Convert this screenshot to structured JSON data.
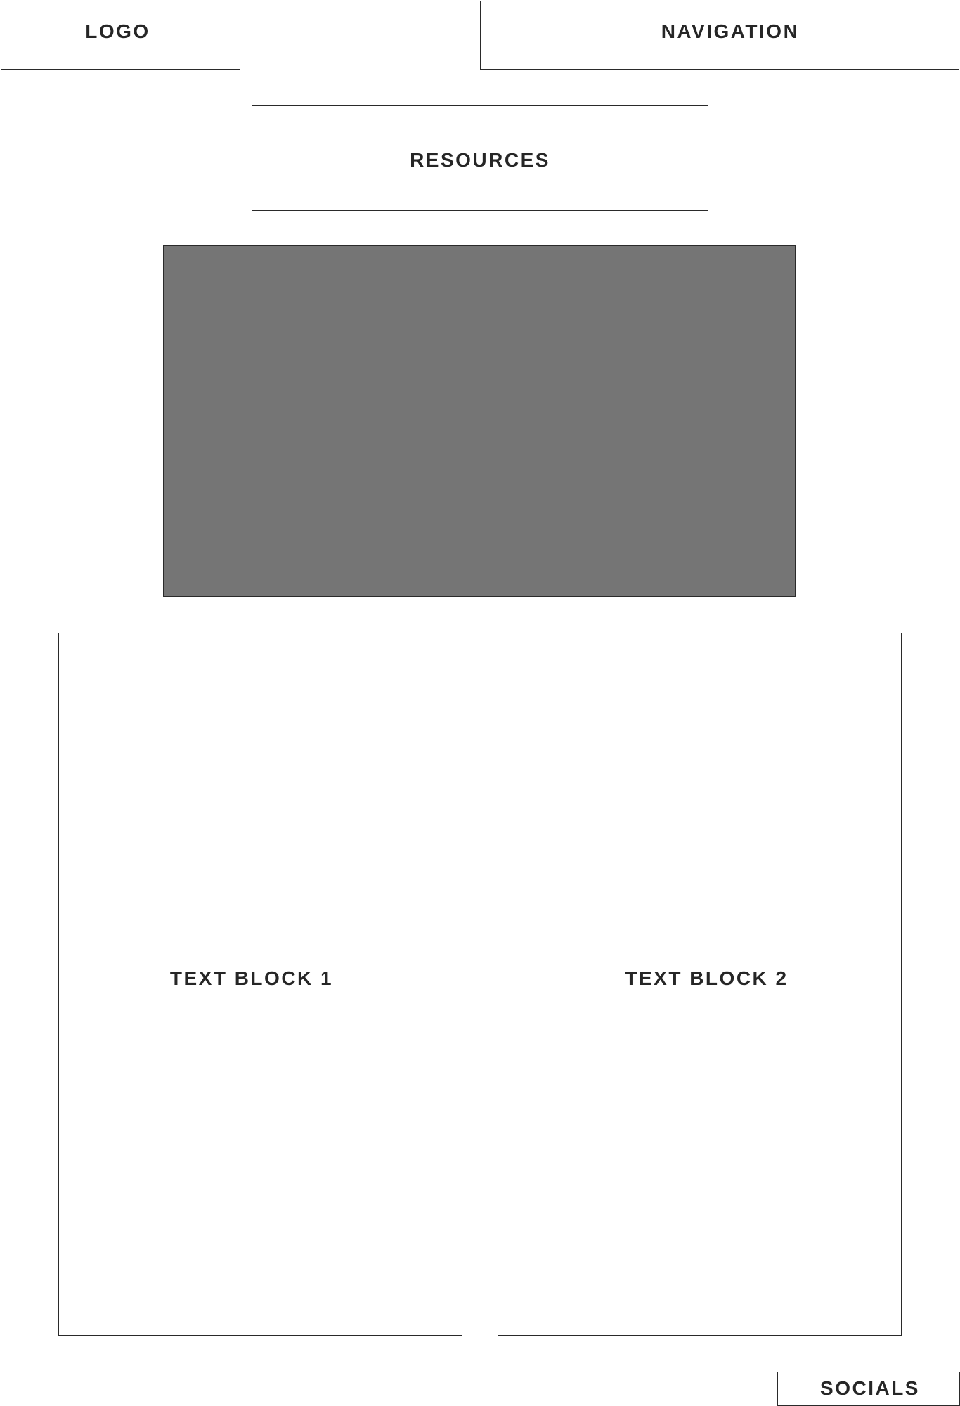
{
  "header": {
    "logo_label": "LOGO",
    "navigation_label": "NAVIGATION"
  },
  "resources": {
    "label": "RESOURCES"
  },
  "hero": {
    "image_color": "#757575"
  },
  "content": {
    "text_block_1_label": "TEXT BLOCK 1",
    "text_block_2_label": "TEXT BLOCK 2"
  },
  "footer": {
    "socials_label": "SOCIALS"
  }
}
